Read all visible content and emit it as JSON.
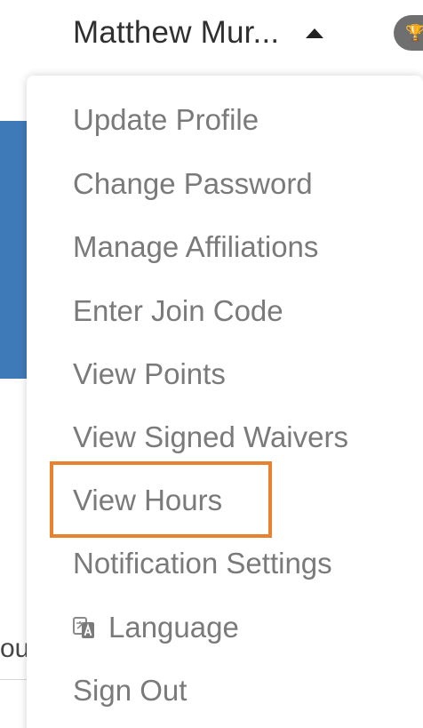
{
  "header": {
    "user_name": "Matthew Mur...",
    "caret_icon": "caret-up-icon",
    "badge_icon": "trophy-icon"
  },
  "background": {
    "fragment_text": "ou"
  },
  "menu": {
    "items": [
      {
        "label": "Update Profile"
      },
      {
        "label": "Change Password"
      },
      {
        "label": "Manage Affiliations"
      },
      {
        "label": "Enter Join Code"
      },
      {
        "label": "View Points"
      },
      {
        "label": "View Signed Waivers"
      },
      {
        "label": "View Hours",
        "highlighted": true
      },
      {
        "label": "Notification Settings"
      },
      {
        "label": "Language",
        "icon": "translate-icon"
      },
      {
        "label": "Sign Out"
      }
    ]
  },
  "colors": {
    "menu_text": "#7a7a7a",
    "header_text": "#2f2f2f",
    "highlight": "#e8822f",
    "background_accent": "#3f7ab8",
    "badge": "#6f6f6f"
  }
}
